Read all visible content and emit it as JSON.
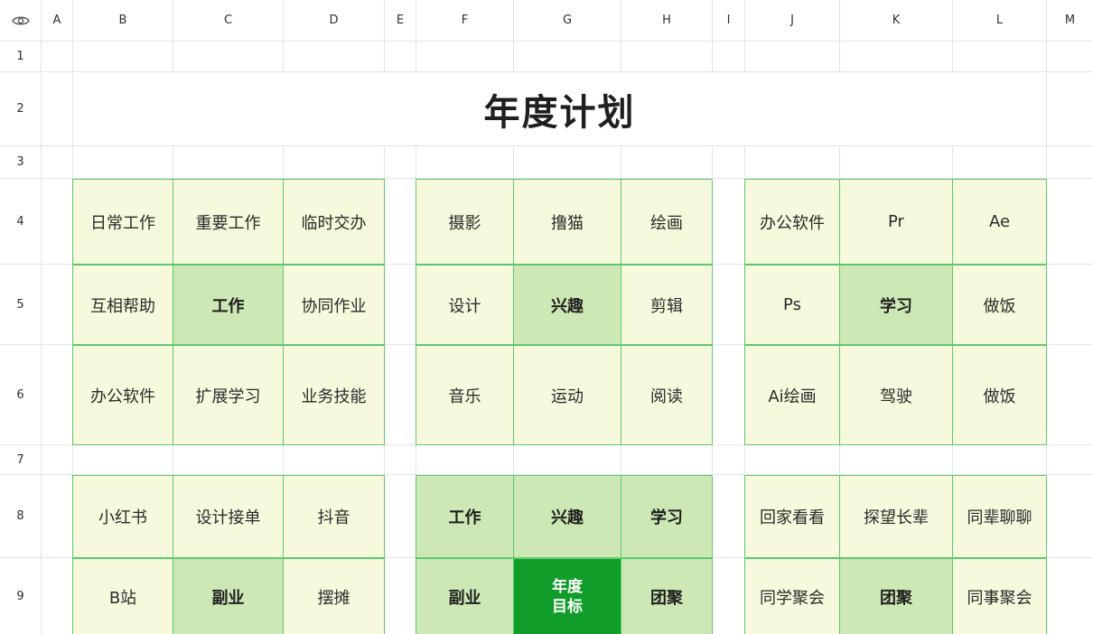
{
  "columns": [
    "A",
    "B",
    "C",
    "D",
    "E",
    "F",
    "G",
    "H",
    "I",
    "J",
    "K",
    "L",
    "M"
  ],
  "rows": [
    "1",
    "2",
    "3",
    "4",
    "5",
    "6",
    "7",
    "8",
    "9"
  ],
  "title": "年度计划",
  "grid": {
    "block_work": [
      [
        "日常工作",
        "重要工作",
        "临时交办"
      ],
      [
        "互相帮助",
        "工作",
        "协同作业"
      ],
      [
        "办公软件",
        "扩展学习",
        "业务技能"
      ]
    ],
    "block_interest": [
      [
        "摄影",
        "撸猫",
        "绘画"
      ],
      [
        "设计",
        "兴趣",
        "剪辑"
      ],
      [
        "音乐",
        "运动",
        "阅读"
      ]
    ],
    "block_study": [
      [
        "办公软件",
        "Pr",
        "Ae"
      ],
      [
        "Ps",
        "学习",
        "做饭"
      ],
      [
        "Ai绘画",
        "驾驶",
        "做饭"
      ]
    ],
    "block_side": [
      [
        "小红书",
        "设计接单",
        "抖音"
      ],
      [
        "B站",
        "副业",
        "摆摊"
      ]
    ],
    "block_center": [
      [
        "工作",
        "兴趣",
        "学习"
      ],
      [
        "副业",
        "年度\n目标",
        "团聚"
      ]
    ],
    "block_reunion": [
      [
        "回家看看",
        "探望长辈",
        "同辈聊聊"
      ],
      [
        "同学聚会",
        "团聚",
        "同事聚会"
      ]
    ]
  },
  "colors": {
    "light_cell": "#f6f9dc",
    "mid_cell": "#cde8b4",
    "center_cell": "#119d29",
    "border": "#5cc96f"
  },
  "icons": {
    "corner": "eye-icon"
  }
}
